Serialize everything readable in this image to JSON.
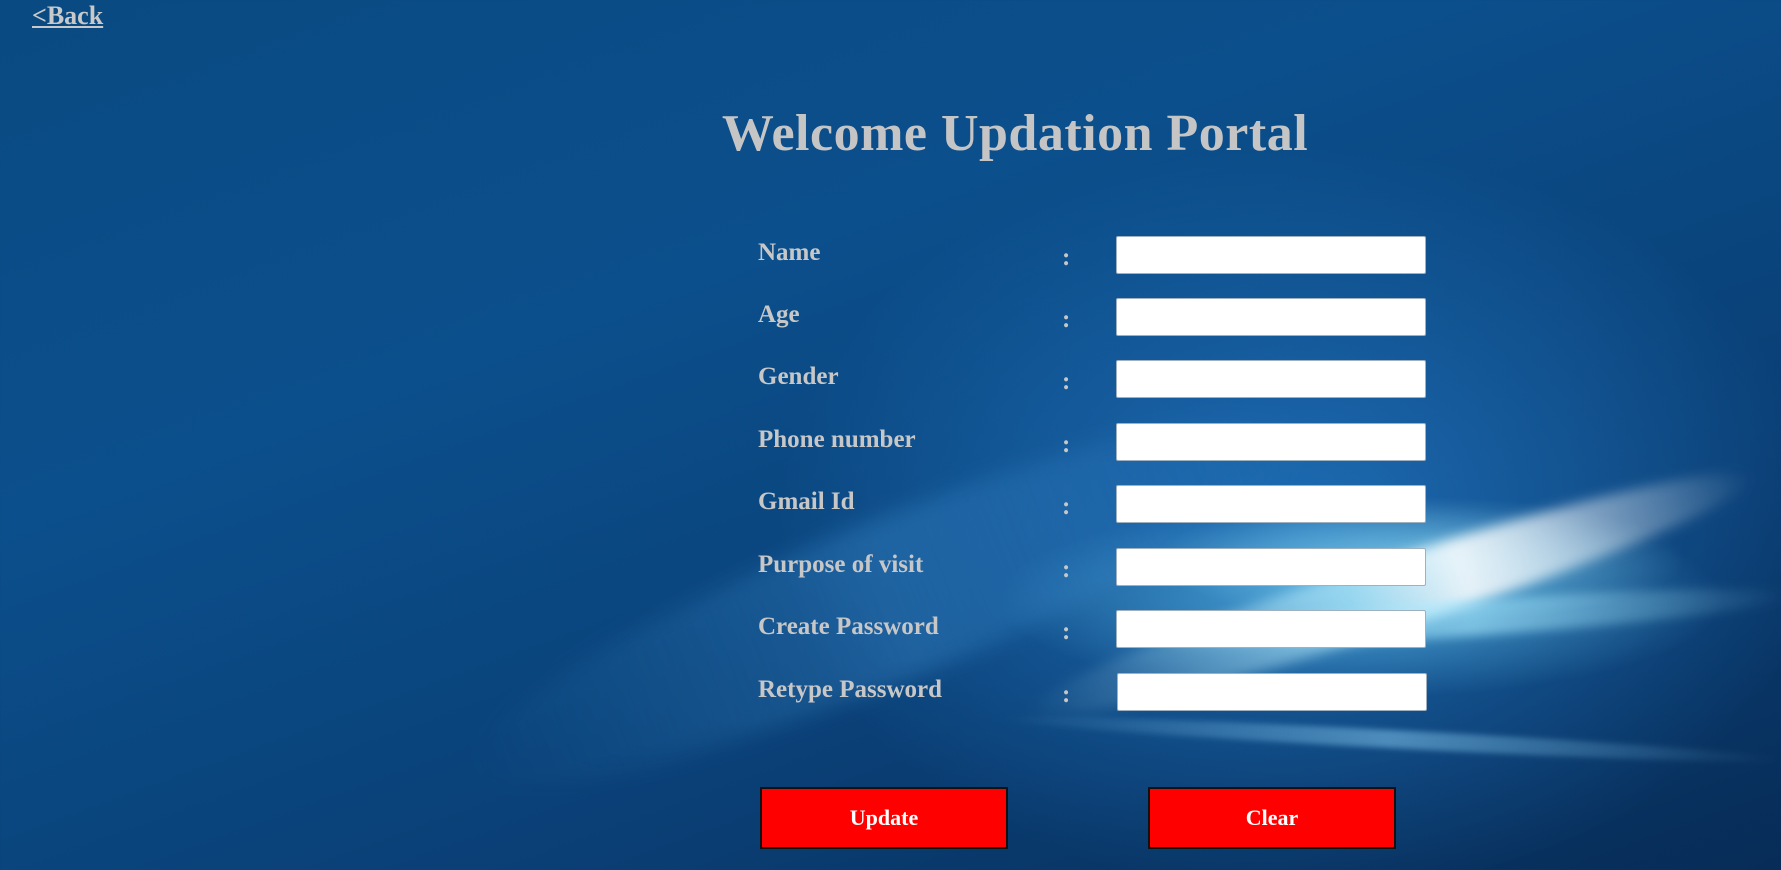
{
  "nav": {
    "back_label": "<Back"
  },
  "page": {
    "title": "Welcome Updation Portal"
  },
  "form": {
    "fields": [
      {
        "label": "Name",
        "separator": ":",
        "value": "",
        "placeholder": ""
      },
      {
        "label": "Age",
        "separator": ":",
        "value": "",
        "placeholder": ""
      },
      {
        "label": "Gender",
        "separator": ":",
        "value": "",
        "placeholder": ""
      },
      {
        "label": "Phone number",
        "separator": ":",
        "value": "",
        "placeholder": ""
      },
      {
        "label": "Gmail Id",
        "separator": ":",
        "value": "",
        "placeholder": ""
      },
      {
        "label": "Purpose of visit",
        "separator": ":",
        "value": "",
        "placeholder": ""
      },
      {
        "label": "Create Password",
        "separator": ":",
        "value": "",
        "placeholder": ""
      },
      {
        "label": "Retype Password",
        "separator": ":",
        "value": "",
        "placeholder": ""
      }
    ],
    "buttons": {
      "update_label": "Update",
      "clear_label": "Clear"
    }
  },
  "colors": {
    "background": "#0b4f8c",
    "button_bg": "#ff0000",
    "label_text": "#c7c7c7"
  }
}
